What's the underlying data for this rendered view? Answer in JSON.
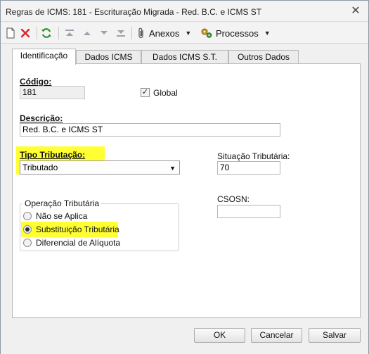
{
  "window": {
    "title": "Regras de ICMS: 181 - Escrituração Migrada - Red. B.C. e  ICMS ST",
    "close_glyph": "✕"
  },
  "toolbar": {
    "anexos_label": "Anexos",
    "processos_label": "Processos",
    "icons": [
      "new-document-icon",
      "delete-icon",
      "refresh-icon",
      "first-record-icon",
      "previous-record-icon",
      "next-record-icon",
      "last-record-icon",
      "paperclip-icon",
      "gears-icon"
    ]
  },
  "tabs": [
    {
      "label": "Identificação",
      "active": true
    },
    {
      "label": "Dados ICMS",
      "active": false
    },
    {
      "label": "Dados ICMS S.T.",
      "active": false
    },
    {
      "label": "Outros Dados",
      "active": false
    }
  ],
  "form": {
    "codigo": {
      "label": "Código:",
      "value": "181"
    },
    "global": {
      "label": "Global",
      "checked": true
    },
    "descricao": {
      "label": "Descrição:",
      "value": "Red. B.C. e  ICMS ST"
    },
    "tipo_tributacao": {
      "label": "Tipo Tributação:",
      "value": "Tributado"
    },
    "situacao_tributaria": {
      "label": "Situação Tributária:",
      "value": "70"
    },
    "csosn": {
      "label": "CSOSN:",
      "value": ""
    },
    "operacao_tributaria": {
      "title": "Operação Tributária",
      "options": [
        {
          "label": "Não se Aplica",
          "selected": false
        },
        {
          "label": "Substituição Tributária",
          "selected": true
        },
        {
          "label": "Diferencial de Alíquota",
          "selected": false
        }
      ]
    }
  },
  "footer": {
    "ok_label": "OK",
    "cancel_label": "Cancelar",
    "save_label": "Salvar"
  },
  "colors": {
    "highlight": "#ffff33",
    "delete_red": "#d9262c",
    "refresh_green": "#2a8f2a"
  }
}
